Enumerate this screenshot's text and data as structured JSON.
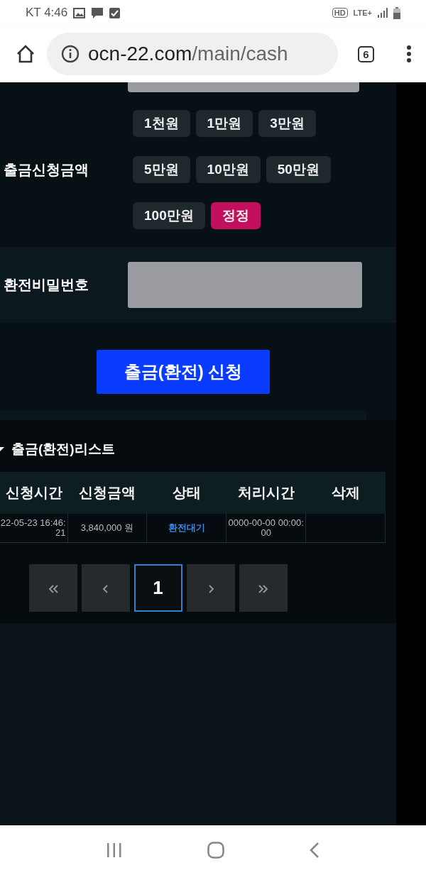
{
  "status_bar": {
    "carrier_time": "KT 4:46",
    "network": "HD",
    "lte": "LTE+"
  },
  "browser": {
    "url_host": "ocn-22.com",
    "url_path": "/main/cash",
    "tab_count": "6"
  },
  "amount": {
    "label": "출금신청금액",
    "buttons": [
      {
        "label": "1천원",
        "kind": "amount"
      },
      {
        "label": "1만원",
        "kind": "amount"
      },
      {
        "label": "3만원",
        "kind": "amount"
      },
      {
        "label": "5만원",
        "kind": "amount"
      },
      {
        "label": "10만원",
        "kind": "amount"
      },
      {
        "label": "50만원",
        "kind": "amount"
      },
      {
        "label": "100만원",
        "kind": "amount"
      },
      {
        "label": "정정",
        "kind": "reset"
      }
    ]
  },
  "password": {
    "label": "환전비밀번호"
  },
  "submit": {
    "label": "출금(환전) 신청"
  },
  "list": {
    "title": "출금(환전)리스트",
    "columns": [
      "신청시간",
      "신청금액",
      "상태",
      "처리시간",
      "삭제"
    ],
    "rows": [
      {
        "requested": "22-05-23 16:46:21",
        "amount": "3,840,000 원",
        "status": "환전대기",
        "processed": "0000-00-00 00:00:00"
      }
    ]
  },
  "pagination": [
    {
      "kind": "first",
      "selected": false
    },
    {
      "kind": "prev",
      "selected": false
    },
    {
      "label": "1",
      "kind": "page",
      "selected": true
    },
    {
      "kind": "next",
      "selected": false
    },
    {
      "kind": "last",
      "selected": false
    }
  ]
}
